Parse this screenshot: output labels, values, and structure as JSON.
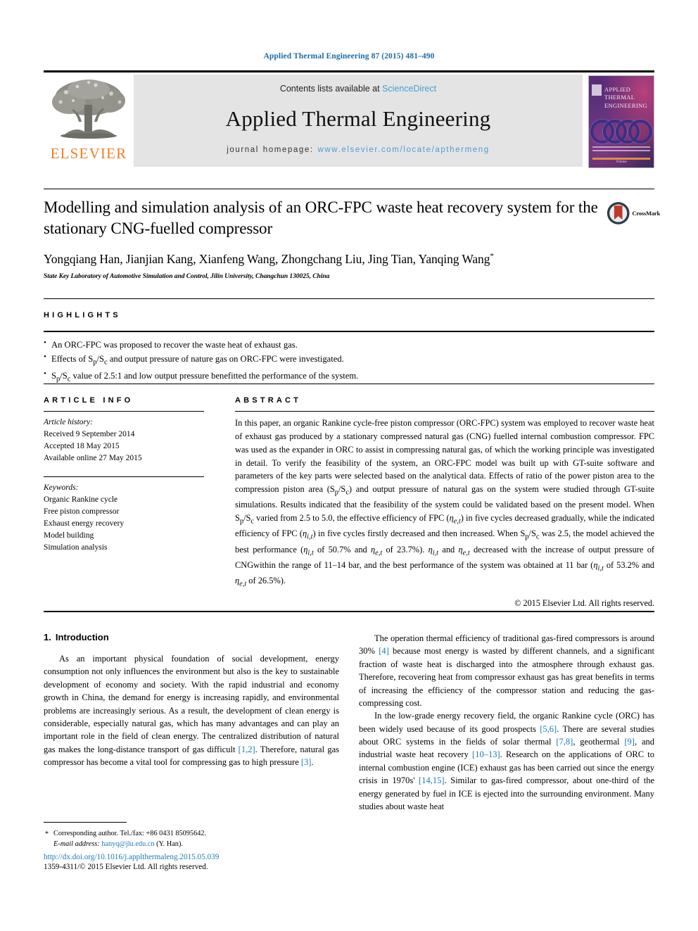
{
  "running_head": "Applied Thermal Engineering 87 (2015) 481–490",
  "masthead": {
    "publisher_name": "ELSEVIER",
    "contents_prefix": "Contents lists available at ",
    "contents_link": "ScienceDirect",
    "journal_title": "Applied Thermal Engineering",
    "homepage_prefix": "journal homepage: ",
    "homepage_url": "www.elsevier.com/locate/apthermeng",
    "cover": {
      "title_line1": "APPLIED",
      "title_line2": "THERMAL",
      "title_line3": "ENGINEERING",
      "footer": "Volume"
    }
  },
  "article": {
    "title": "Modelling and simulation analysis of an ORC-FPC waste heat recovery system for the stationary CNG-fuelled compressor",
    "authors": "Yongqiang Han, Jianjian Kang, Xianfeng Wang, Zhongchang Liu, Jing Tian, Yanqing Wang",
    "author_marker": "*",
    "affiliation": "State Key Laboratory of Automotive Simulation and Control, Jilin University, Changchun 130025, China",
    "crossmark_label": "CrossMark"
  },
  "highlights": {
    "heading": "HIGHLIGHTS",
    "items": [
      "An ORC-FPC was proposed to recover the waste heat of exhaust gas.",
      "Effects of Sp/Sc and output pressure of nature gas on ORC-FPC were investigated.",
      "Sp/Sc value of 2.5:1 and low output pressure benefitted the performance of the system."
    ]
  },
  "article_info": {
    "heading": "ARTICLE INFO",
    "history_label": "Article history:",
    "history": [
      "Received 9 September 2014",
      "Accepted 18 May 2015",
      "Available online 27 May 2015"
    ],
    "keywords_label": "Keywords:",
    "keywords": [
      "Organic Rankine cycle",
      "Free piston compressor",
      "Exhaust energy recovery",
      "Model building",
      "Simulation analysis"
    ]
  },
  "abstract": {
    "heading": "ABSTRACT",
    "text": "In this paper, an organic Rankine cycle-free piston compressor (ORC-FPC) system was employed to recover waste heat of exhaust gas produced by a stationary compressed natural gas (CNG) fuelled internal combustion compressor. FPC was used as the expander in ORC to assist in compressing natural gas, of which the working principle was investigated in detail. To verify the feasibility of the system, an ORC-FPC model was built up with GT-suite software and parameters of the key parts were selected based on the analytical data. Effects of ratio of the power piston area to the compression piston area (Sp/Sc) and output pressure of natural gas on the system were studied through GT-suite simulations. Results indicated that the feasibility of the system could be validated based on the present model. When Sp/Sc varied from 2.5 to 5.0, the effective efficiency of FPC (ηe,t) in five cycles decreased gradually, while the indicated efficiency of FPC (ηi,t) in five cycles firstly decreased and then increased. When Sp/Sc was 2.5, the model achieved the best performance (ηi,t of 50.7% and ηe,t of 23.7%). ηi,t and ηe,t decreased with the increase of output pressure of CNGwithin the range of 11–14 bar, and the best performance of the system was obtained at 11 bar (ηi,t of 53.2% and ηe,t of 26.5%).",
    "copyright": "© 2015 Elsevier Ltd. All rights reserved."
  },
  "introduction": {
    "number": "1.",
    "heading": "Introduction",
    "left_paragraphs": [
      "As an important physical foundation of social development, energy consumption not only influences the environment but also is the key to sustainable development of economy and society. With the rapid industrial and economy growth in China, the demand for energy is increasing rapidly, and environmental problems are increasingly serious. As a result, the development of clean energy is considerable, especially natural gas, which has many advantages and can play an important role in the field of clean energy. The centralized distribution of natural gas makes the long-distance transport of gas difficult [1,2]. Therefore, natural gas compressor has become a vital tool for compressing gas to high pressure [3]."
    ],
    "right_paragraphs": [
      "The operation thermal efficiency of traditional gas-fired compressors is around 30% [4] because most energy is wasted by different channels, and a significant fraction of waste heat is discharged into the atmosphere through exhaust gas. Therefore, recovering heat from compressor exhaust gas has great benefits in terms of increasing the efficiency of the compressor station and reducing the gas-compressing cost.",
      "In the low-grade energy recovery field, the organic Rankine cycle (ORC) has been widely used because of its good prospects [5,6]. There are several studies about ORC systems in the fields of solar thermal [7,8], geothermal [9], and industrial waste heat recovery [10–13]. Research on the applications of ORC to internal combustion engine (ICE) exhaust gas has been carried out since the energy crisis in 1970s' [14,15]. Similar to gas-fired compressor, about one-third of the energy generated by fuel in ICE is ejected into the surrounding environment. Many studies about waste heat"
    ]
  },
  "footnote": {
    "star": "*",
    "corresponding": "Corresponding author. Tel./fax: +86 0431 85095642.",
    "email_label": "E-mail address:",
    "email": "hanyq@jlu.edu.cn",
    "email_suffix": "(Y. Han)."
  },
  "footer": {
    "doi": "http://dx.doi.org/10.1016/j.applthermaleng.2015.05.039",
    "issn": "1359-4311/© 2015 Elsevier Ltd. All rights reserved."
  },
  "colors": {
    "link": "#1b7ab5",
    "running_head": "#1b6ca8",
    "elsevier_orange": "#f07e26",
    "band_gray": "#e4e4e4"
  }
}
